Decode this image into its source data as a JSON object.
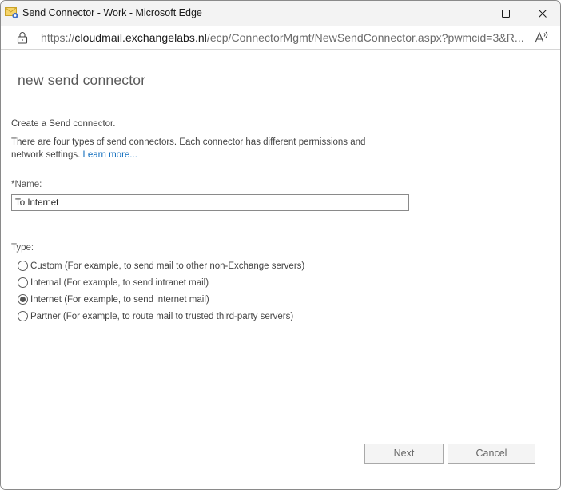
{
  "window": {
    "title": "Send Connector - Work - Microsoft Edge",
    "controls": {
      "minimize": "minimize",
      "maximize": "maximize",
      "close": "close"
    }
  },
  "addressbar": {
    "url_scheme": "https://",
    "url_domain": "cloudmail.exchangelabs.nl",
    "url_path": "/ecp/ConnectorMgmt/NewSendConnector.aspx?pwmcid=3&R..."
  },
  "page": {
    "title": "new send connector",
    "intro_line1": "Create a Send connector.",
    "intro_line2": "There are four types of send connectors. Each connector has different permissions and network settings.",
    "learn_more": "Learn more..."
  },
  "form": {
    "name_label": "*Name:",
    "name_value": "To Internet",
    "type_label": "Type:",
    "type_options": [
      {
        "label": "Custom (For example, to send mail to other non-Exchange servers)",
        "checked": false
      },
      {
        "label": "Internal (For example, to send intranet mail)",
        "checked": false
      },
      {
        "label": "Internet (For example, to send internet mail)",
        "checked": true
      },
      {
        "label": "Partner (For example, to route mail to trusted third-party servers)",
        "checked": false
      }
    ]
  },
  "buttons": {
    "next": "Next",
    "cancel": "Cancel"
  }
}
